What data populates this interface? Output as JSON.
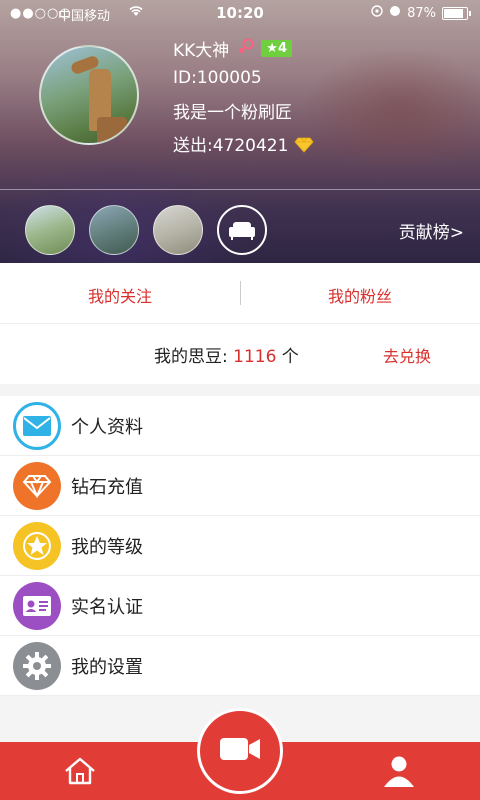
{
  "status_bar": {
    "signal": "●●○○○",
    "carrier": "中国移动",
    "time": "10:20",
    "battery": "87%"
  },
  "profile": {
    "name": "KK大神",
    "gender_icon": "female-symbol-icon",
    "level": "4",
    "id": "ID:100005",
    "signature": "我是一个粉刷匠",
    "sent": "送出:4720421"
  },
  "contribution": {
    "label": "贡献榜>",
    "more_icon": "sofa-icon"
  },
  "follow": {
    "following": "我的关注",
    "fans": "我的粉丝"
  },
  "beans": {
    "prefix": "我的思豆: ",
    "count": "1116",
    "suffix": " 个",
    "exchange": "去兑换"
  },
  "menu": [
    {
      "label": "个人资料",
      "icon": "mail-icon"
    },
    {
      "label": "钻石充值",
      "icon": "diamond-icon"
    },
    {
      "label": "我的等级",
      "icon": "star-icon"
    },
    {
      "label": "实名认证",
      "icon": "id-card-icon"
    },
    {
      "label": "我的设置",
      "icon": "gear-icon"
    }
  ],
  "tabbar": {
    "home_icon": "home-icon",
    "center_icon": "video-camera-icon",
    "me_icon": "user-icon"
  },
  "colors": {
    "accent": "#e23c36",
    "text_red": "#d9302d",
    "level_badge": "#6fcf3f"
  }
}
